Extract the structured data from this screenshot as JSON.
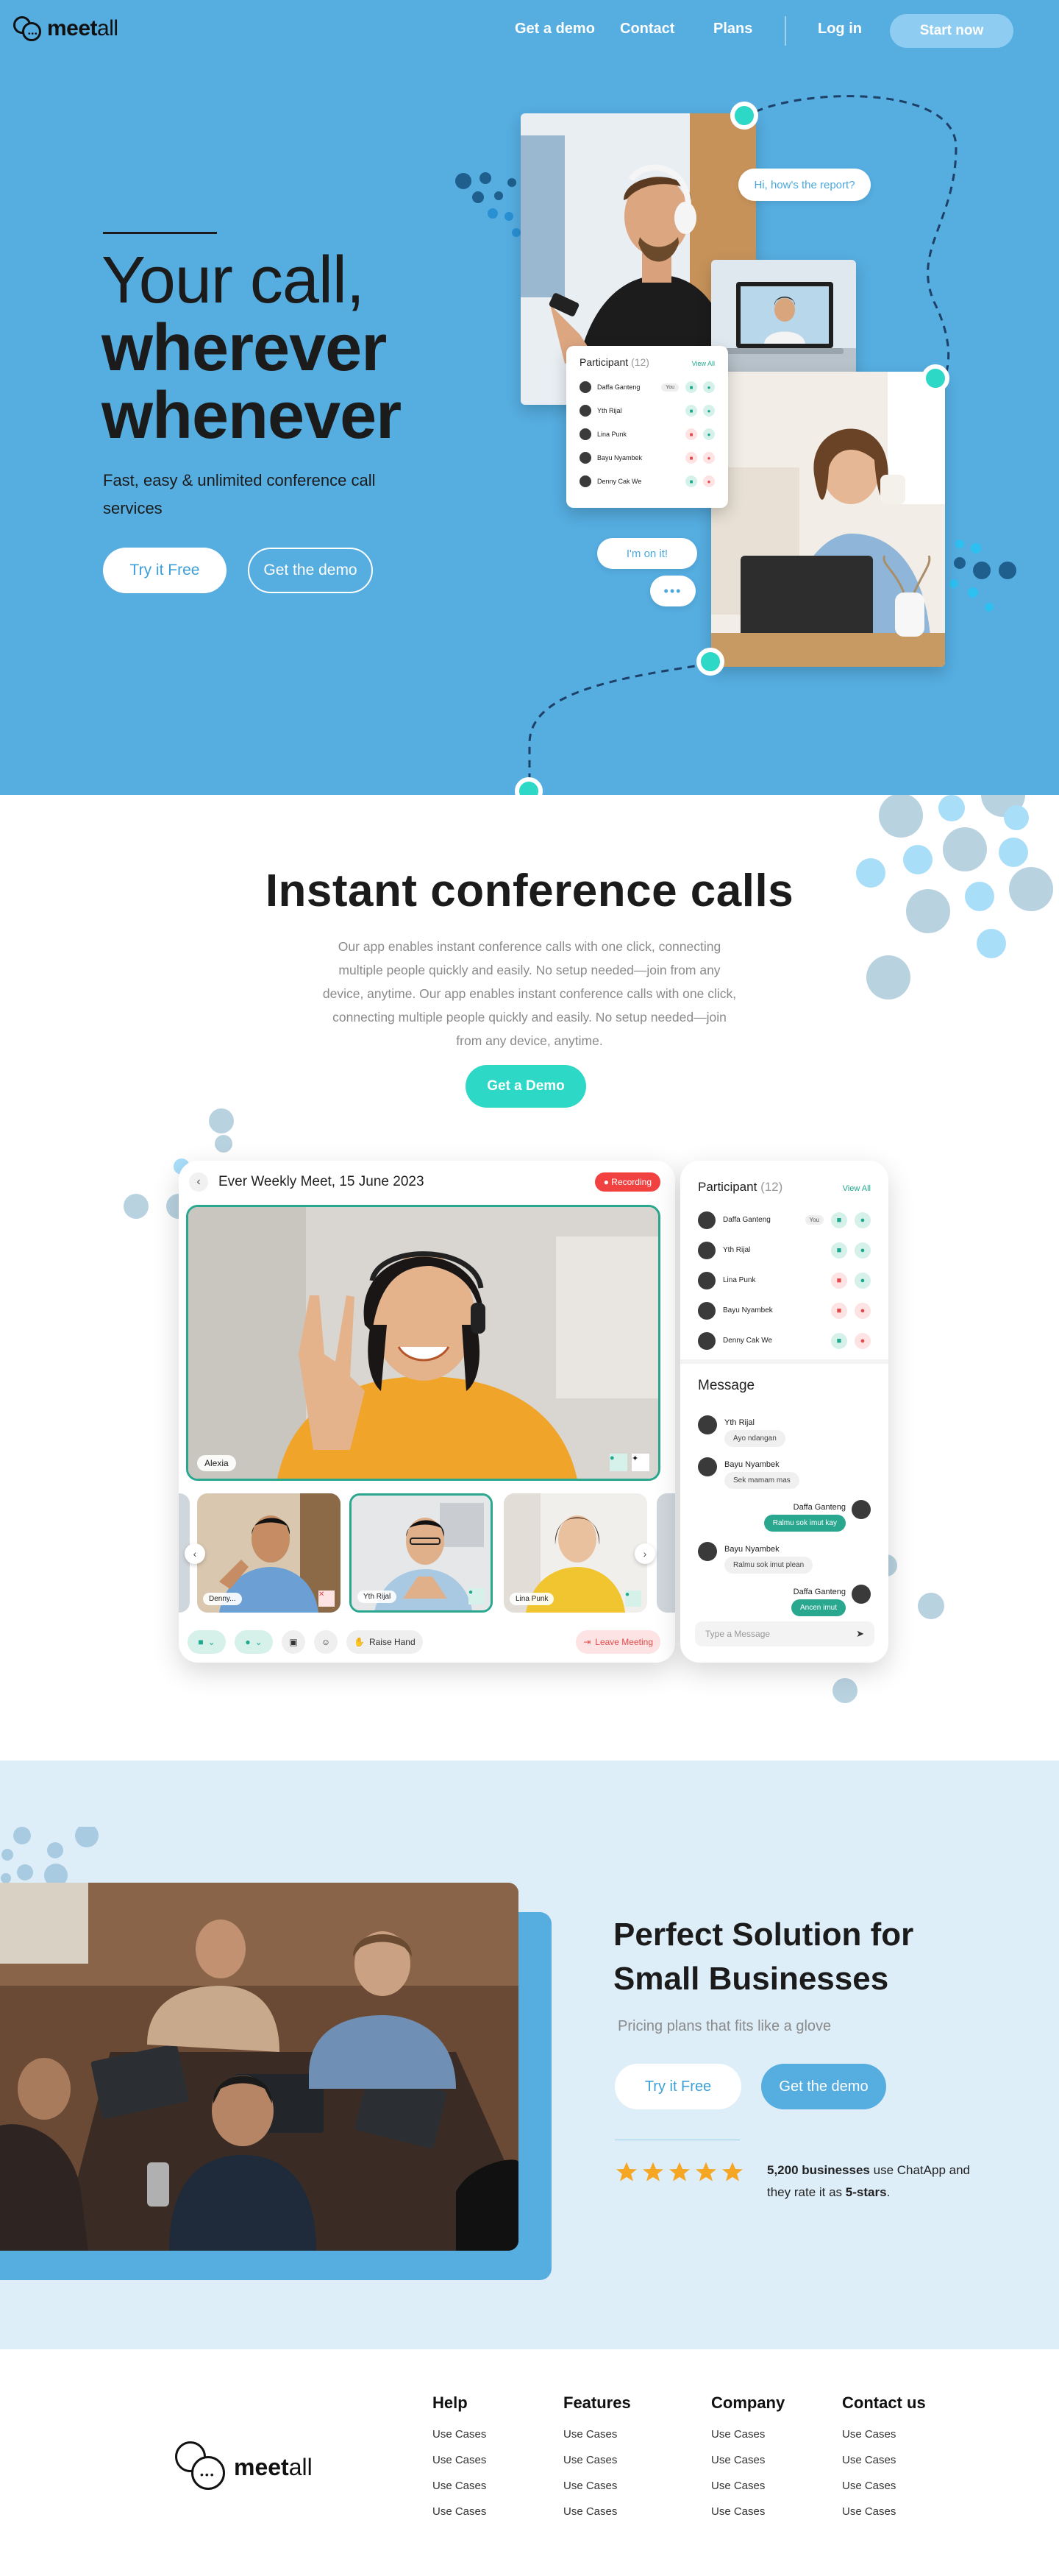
{
  "brand": {
    "name_bold": "meet",
    "name_light": "all"
  },
  "nav": {
    "links": [
      "Get a demo",
      "Contact",
      "Plans",
      "Log in"
    ],
    "cta": "Start now"
  },
  "hero": {
    "title_line1": "Your call,",
    "title_line2": "wherever",
    "title_line3": "whenever",
    "subtitle": "Fast, easy & unlimited conference call services",
    "try_button": "Try it Free",
    "demo_button": "Get the demo",
    "chat_bubble_1": "Hi, how's the report?",
    "chat_bubble_2": "I'm on it!",
    "typing_dots": "•••"
  },
  "participants_card": {
    "title": "Participant",
    "count": "(12)",
    "view_all": "View All",
    "you_badge": "You",
    "people": [
      "Daffa Ganteng",
      "Yth Rijal",
      "Lina Punk",
      "Bayu Nyambek",
      "Denny Cak We"
    ]
  },
  "conference": {
    "title": "Instant conference calls",
    "description": "Our app enables instant conference calls with one click, connecting multiple people quickly and easily.  No setup needed—join from any device, anytime. Our app enables instant conference calls with one click, connecting multiple people quickly and easily.  No setup needed—join from any device, anytime.",
    "cta": "Get a Demo"
  },
  "call_ui": {
    "meeting_title": "Ever Weekly Meet, 15 June 2023",
    "recording_label": "Recording",
    "main_speaker": "Alexia",
    "thumbnails": [
      "Denny...",
      "Yth Rijal",
      "Lina Punk"
    ],
    "raise_hand": "Raise Hand",
    "leave": "Leave Meeting",
    "message_title": "Message",
    "messages": [
      {
        "from": "Yth Rijal",
        "text": "Ayo ndangan",
        "side": "left"
      },
      {
        "from": "Bayu Nyambek",
        "text": "Sek mamam mas",
        "side": "left"
      },
      {
        "from": "Daffa Ganteng",
        "text": "Ralmu sok imut kay",
        "side": "right"
      },
      {
        "from": "Bayu Nyambek",
        "text": "Ralmu sok imut plean",
        "side": "left"
      },
      {
        "from": "Daffa Ganteng",
        "text": "Ancen imut",
        "side": "right"
      }
    ],
    "message_placeholder": "Type a Message"
  },
  "small_business": {
    "title": "Perfect Solution for Small Businesses",
    "subtitle": "Pricing plans that fits like a glove",
    "try_button": "Try it Free",
    "demo_button": "Get the demo",
    "stars": 5,
    "rating_count": "5,200 businesses",
    "rating_text_1": "use ChatApp and they rate it as",
    "rating_stars_text": "5-stars",
    "rating_end": "."
  },
  "footer": {
    "columns": [
      {
        "title": "Help",
        "links": [
          "Use Cases",
          "Use Cases",
          "Use Cases",
          "Use Cases"
        ]
      },
      {
        "title": "Features",
        "links": [
          "Use Cases",
          "Use Cases",
          "Use Cases",
          "Use Cases"
        ]
      },
      {
        "title": "Company",
        "links": [
          "Use Cases",
          "Use Cases",
          "Use Cases",
          "Use Cases"
        ]
      },
      {
        "title": "Contact us",
        "links": [
          "Use Cases",
          "Use Cases",
          "Use Cases",
          "Use Cases"
        ]
      }
    ]
  },
  "colors": {
    "hero_bg": "#55ade0",
    "teal": "#2ed8c6",
    "green": "#2aa78f",
    "light_blue_bg": "#deeef9",
    "star": "#f5a623",
    "recording": "#f24141"
  }
}
